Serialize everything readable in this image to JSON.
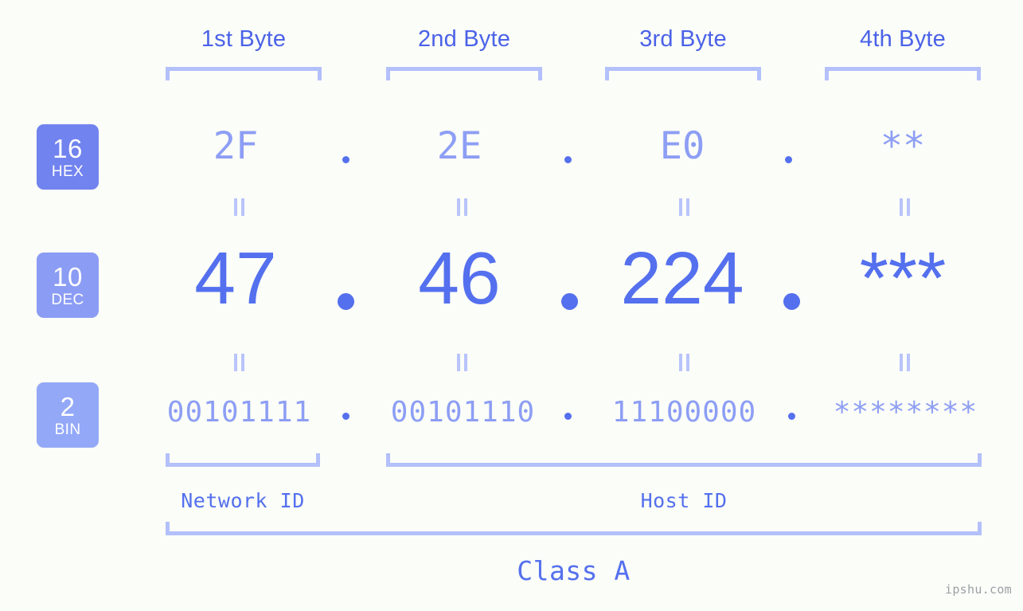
{
  "meta": {
    "background_color": "#fbfdf8",
    "accent_strong": "#5470ee",
    "accent_mid": "#8d9ef4",
    "accent_light": "#b3c0fb",
    "watermark": "ipshu.com"
  },
  "header": {
    "byte_labels": [
      "1st Byte",
      "2nd Byte",
      "3rd Byte",
      "4th Byte"
    ]
  },
  "bases": [
    {
      "num": "16",
      "name": "HEX",
      "color": "#7183ee"
    },
    {
      "num": "10",
      "name": "DEC",
      "color": "#8b9cf4"
    },
    {
      "num": "2",
      "name": "BIN",
      "color": "#93a8f7"
    }
  ],
  "rows": {
    "hex": {
      "base_num": "16",
      "base_name": "HEX",
      "values": [
        "2F",
        "2E",
        "E0",
        "**"
      ],
      "separator": "."
    },
    "dec": {
      "base_num": "10",
      "base_name": "DEC",
      "values": [
        "47",
        "46",
        "224",
        "***"
      ],
      "separator": "."
    },
    "bin": {
      "base_num": "2",
      "base_name": "BIN",
      "values": [
        "00101111",
        "00101110",
        "11100000",
        "********"
      ],
      "separator": "."
    }
  },
  "equals_marks": {
    "symbol": "=",
    "count_per_row": 4
  },
  "footer": {
    "network_id_label": "Network ID",
    "host_id_label": "Host ID",
    "class_label": "Class A"
  }
}
